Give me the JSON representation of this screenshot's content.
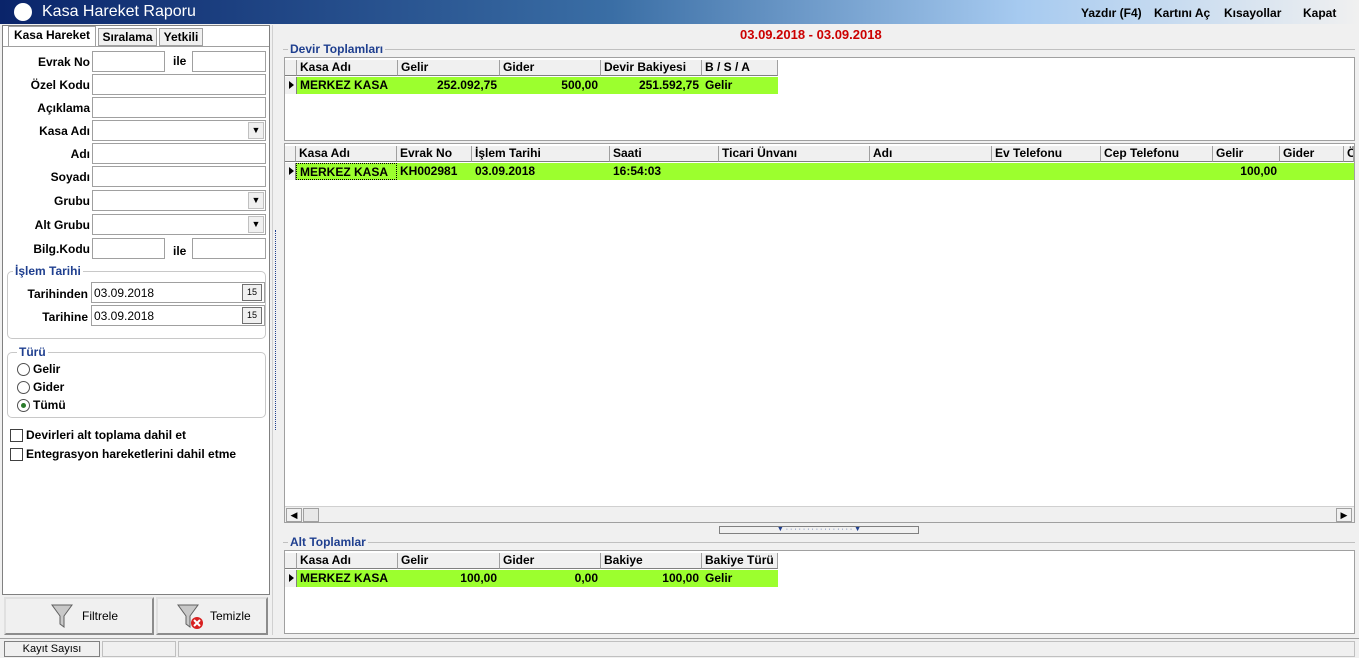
{
  "app": {
    "title": "Kasa Hareket Raporu"
  },
  "menu": {
    "print": "Yazdır (F4)",
    "open_card": "Kartını Aç",
    "shortcuts": "Kısayollar",
    "close": "Kapat"
  },
  "date_range": "03.09.2018 - 03.09.2018",
  "tabs": [
    {
      "label": "Kasa Hareket"
    },
    {
      "label": "Sıralama"
    },
    {
      "label": "Yetkili"
    }
  ],
  "filters": {
    "evrak_no_label": "Evrak No",
    "ile_label": "ile",
    "ozel_kodu_label": "Özel Kodu",
    "aciklama_label": "Açıklama",
    "kasa_adi_label": "Kasa Adı",
    "adi_label": "Adı",
    "soyadi_label": "Soyadı",
    "grubu_label": "Grubu",
    "alt_grubu_label": "Alt Grubu",
    "bilg_kodu_label": "Bilg.Kodu",
    "ile2_label": "ile"
  },
  "islem_tarihi": {
    "title": "İşlem Tarihi",
    "from_label": "Tarihinden",
    "from_value": "03.09.2018",
    "to_label": "Tarihine",
    "to_value": "03.09.2018"
  },
  "turu": {
    "title": "Türü",
    "options": [
      {
        "label": "Gelir",
        "selected": false
      },
      {
        "label": "Gider",
        "selected": false
      },
      {
        "label": "Tümü",
        "selected": true
      }
    ]
  },
  "checkboxes": [
    {
      "label": "Devirleri alt toplama dahil et",
      "checked": false
    },
    {
      "label": "Entegrasyon hareketlerini dahil etme",
      "checked": false
    }
  ],
  "buttons": {
    "filter": "Filtrele",
    "clear": "Temizle"
  },
  "devir": {
    "title": "Devir Toplamları",
    "columns": [
      "Kasa Adı",
      "Gelir",
      "Gider",
      "Devir Bakiyesi",
      "B / S / A"
    ],
    "row": [
      "MERKEZ KASA",
      "252.092,75",
      "500,00",
      "251.592,75",
      "Gelir"
    ]
  },
  "main_grid": {
    "columns": [
      "Kasa Adı",
      "Evrak No",
      "İşlem Tarihi",
      "Saati",
      "Ticari Ünvanı",
      "Adı",
      "Ev Telefonu",
      "Cep Telefonu",
      "Gelir",
      "Gider",
      "Ö"
    ],
    "row": [
      "MERKEZ KASA",
      "KH002981",
      "03.09.2018",
      "16:54:03",
      "",
      "",
      "",
      "",
      "100,00",
      "",
      ""
    ]
  },
  "alt": {
    "title": "Alt Toplamlar",
    "columns": [
      "Kasa Adı",
      "Gelir",
      "Gider",
      "Bakiye",
      "Bakiye Türü"
    ],
    "row": [
      "MERKEZ KASA",
      "100,00",
      "0,00",
      "100,00",
      "Gelir"
    ]
  },
  "status": {
    "record_count_label": "Kayıt Sayısı"
  },
  "colors": {
    "selected_row": "#9cff2e",
    "date_range": "#cc0000",
    "section_title": "#1f3f8f"
  }
}
